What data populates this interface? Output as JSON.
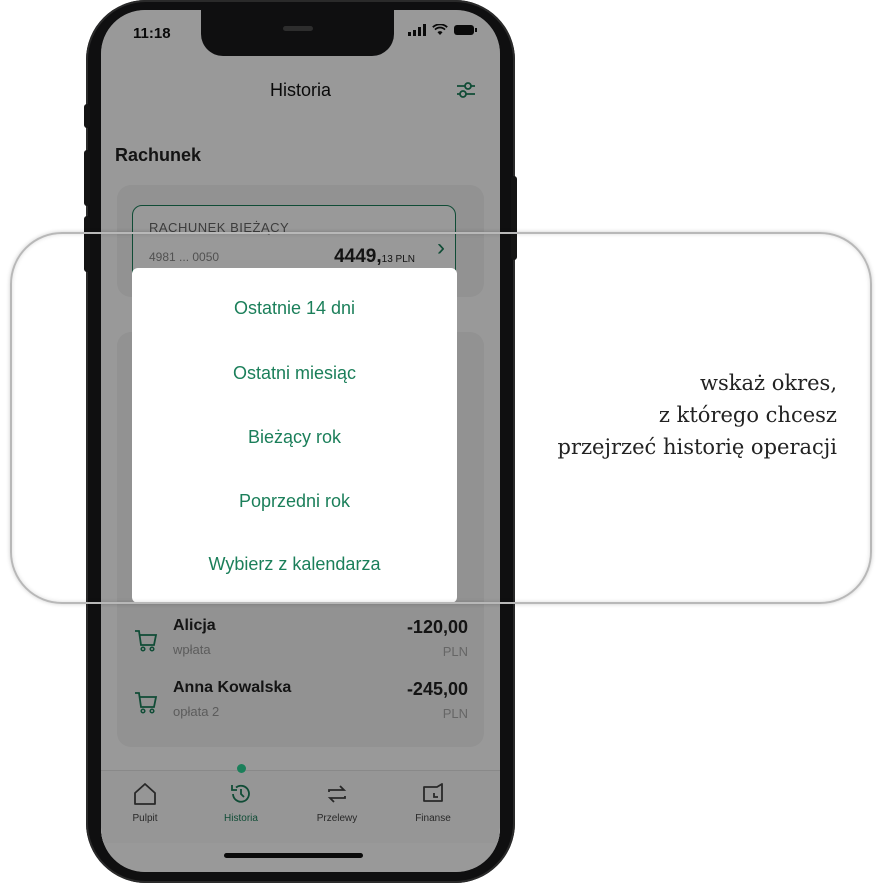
{
  "status_bar": {
    "time": "11:18"
  },
  "header": {
    "title": "Historia",
    "filter_icon": "filter-sliders-icon"
  },
  "section": {
    "title": "Rachunek"
  },
  "account": {
    "name": "RACHUNEK BIEŻĄCY",
    "number": "4981 ... 0050",
    "balance": "4449",
    "balance_decimal": "13 PLN"
  },
  "transactions": [
    {
      "name": "Alicja",
      "desc": "wpłata",
      "amount": "-120,00",
      "currency": "PLN"
    },
    {
      "name": "Anna Kowalska",
      "desc": "opłata 2",
      "amount": "-245,00",
      "currency": "PLN"
    }
  ],
  "period_popup": {
    "options": [
      "Ostatnie 14 dni",
      "Ostatni miesiąc",
      "Bieżący rok",
      "Poprzedni rok",
      "Wybierz z kalendarza"
    ]
  },
  "tabbar": {
    "tabs": [
      {
        "label": "Pulpit",
        "icon": "home-icon"
      },
      {
        "label": "Historia",
        "icon": "history-icon"
      },
      {
        "label": "Przelewy",
        "icon": "transfer-icon"
      },
      {
        "label": "Finanse",
        "icon": "finance-icon"
      }
    ],
    "active": "Historia"
  },
  "hint": {
    "lines": [
      "wskaż okres,",
      "z którego chcesz",
      "przejrzeć historię operacji"
    ]
  },
  "colors": {
    "accent": "#1b7f5a",
    "frame": "#0f0f10"
  }
}
